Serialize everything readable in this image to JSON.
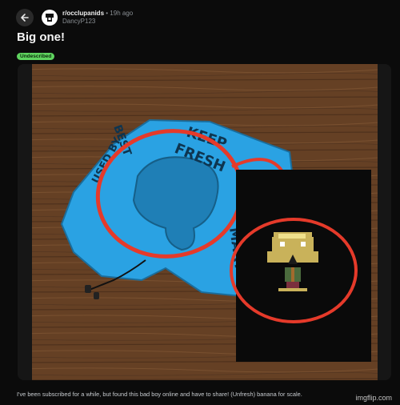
{
  "post": {
    "subreddit": "r/occlupanids",
    "separator": "•",
    "time_ago": "19h ago",
    "author": "DancyP123",
    "title": "Big one!",
    "flair": "Undescribed",
    "body": "I've been subscribed for a while, but found this bad boy online and have to share! (Unfresh) banana for scale."
  },
  "photo": {
    "pillow_text": [
      "KEEP",
      "FRESH",
      "BEST",
      "USED BY",
      "MART"
    ]
  },
  "watermark": "imgflip.com",
  "icons": {
    "back": "arrow-left-icon",
    "subreddit": "occlupanid-logo-icon"
  },
  "colors": {
    "background": "#0b0b0b",
    "flair": "#5fd35f",
    "annotation": "#e53a2a",
    "pillow": "#2aa2e3",
    "floor": "#7a4e2e"
  }
}
